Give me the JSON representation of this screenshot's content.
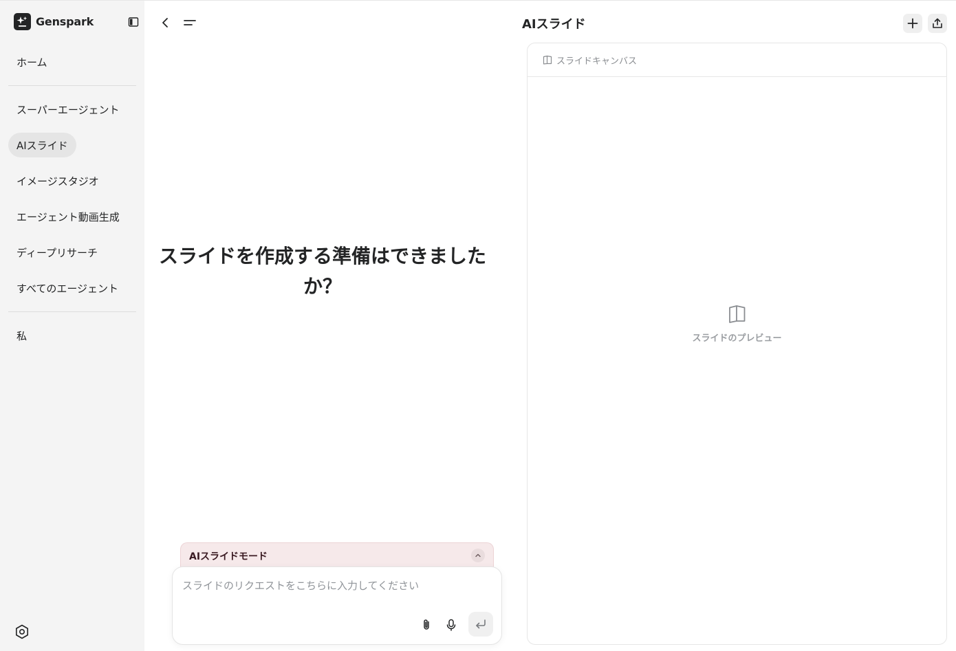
{
  "brand": {
    "name": "Genspark"
  },
  "sidebar": {
    "items": [
      {
        "label": "ホーム"
      },
      {
        "label": "スーパーエージェント"
      },
      {
        "label": "AIスライド"
      },
      {
        "label": "イメージスタジオ"
      },
      {
        "label": "エージェント動画生成"
      },
      {
        "label": "ディープリサーチ"
      },
      {
        "label": "すべてのエージェント"
      },
      {
        "label": "私"
      }
    ],
    "active_item": "AIスライド"
  },
  "header": {
    "title": "AIスライド"
  },
  "chat": {
    "headline": "スライドを作成する準備はできましたか？",
    "mode_label": "AIスライドモード",
    "input": {
      "value": "",
      "placeholder": "スライドのリクエストをこちらに入力してください"
    }
  },
  "canvas": {
    "tab_label": "スライドキャンバス",
    "preview_label": "スライドのプレビュー"
  },
  "icons": {
    "logo": "genspark-sparkle-icon",
    "collapse": "sidebar-panel-icon",
    "settings": "settings-hexagon-icon",
    "back": "chevron-left-icon",
    "menu": "menu-lines-icon",
    "new": "plus-icon",
    "share": "share-upload-icon",
    "mode_toggle": "chevron-up-icon",
    "attach": "paperclip-icon",
    "mic": "microphone-icon",
    "send": "enter-return-icon",
    "slide": "slide-book-icon"
  },
  "colors": {
    "sidebar_bg": "#f4f4f4",
    "active_item_bg": "#e5e5e5",
    "mode_bar_bg": "#f6e9ea",
    "text_primary": "#232425",
    "text_muted": "#909499"
  }
}
